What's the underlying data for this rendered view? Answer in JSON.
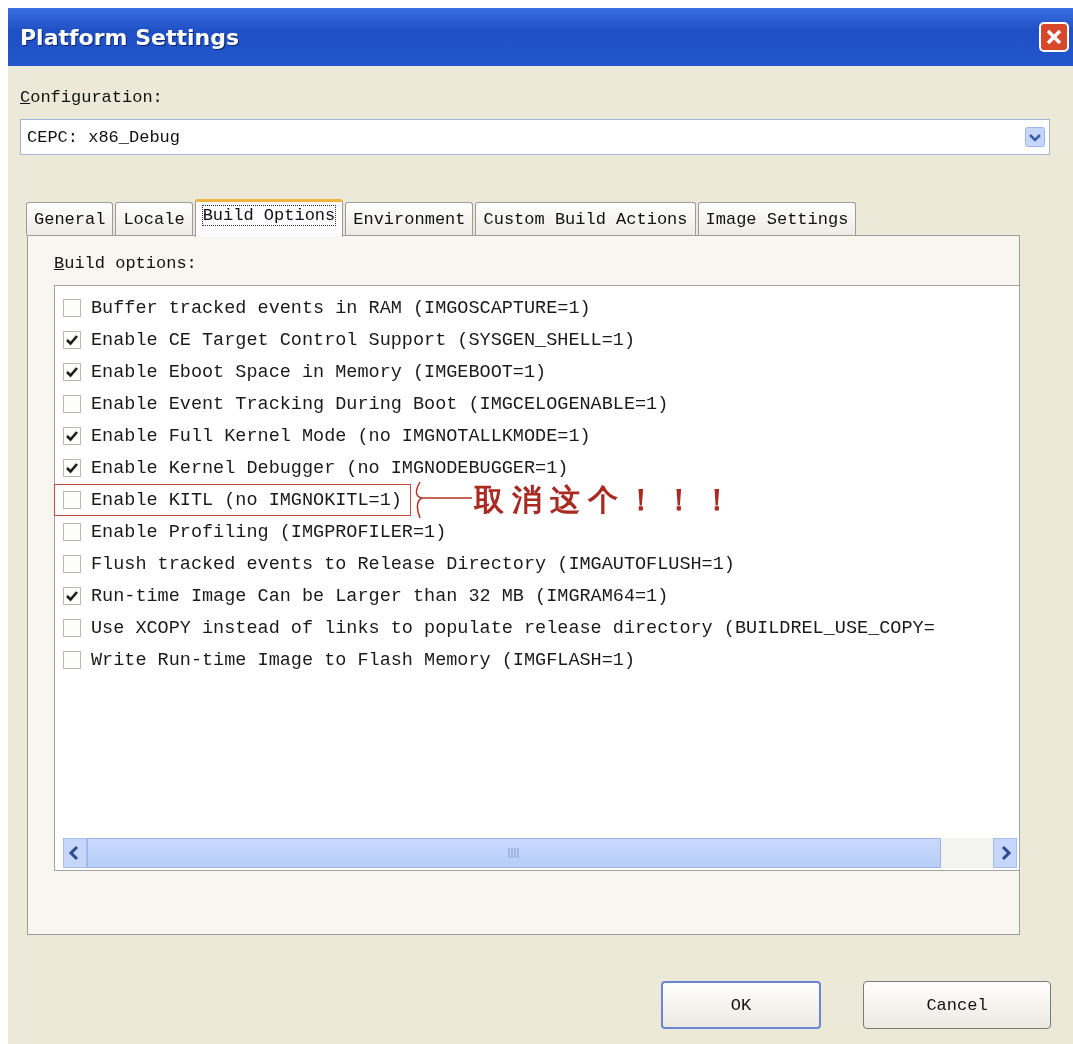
{
  "window": {
    "title": "Platform Settings"
  },
  "configuration": {
    "label": "Configuration:",
    "value": "CEPC: x86_Debug"
  },
  "tabs": [
    {
      "label": "General",
      "selected": false
    },
    {
      "label": "Locale",
      "selected": false
    },
    {
      "label": "Build Options",
      "selected": true
    },
    {
      "label": "Environment",
      "selected": false
    },
    {
      "label": "Custom Build Actions",
      "selected": false
    },
    {
      "label": "Image Settings",
      "selected": false
    }
  ],
  "build_options": {
    "label": "Build options:",
    "items": [
      {
        "label": "Buffer tracked events in RAM (IMGOSCAPTURE=1)",
        "checked": false,
        "highlighted": false
      },
      {
        "label": "Enable CE Target Control Support (SYSGEN_SHELL=1)",
        "checked": true,
        "highlighted": false
      },
      {
        "label": "Enable Eboot Space in Memory (IMGEBOOT=1)",
        "checked": true,
        "highlighted": false
      },
      {
        "label": "Enable Event Tracking During Boot (IMGCELOGENABLE=1)",
        "checked": false,
        "highlighted": false
      },
      {
        "label": "Enable Full Kernel Mode (no IMGNOTALLKMODE=1)",
        "checked": true,
        "highlighted": false
      },
      {
        "label": "Enable Kernel Debugger (no IMGNODEBUGGER=1)",
        "checked": true,
        "highlighted": false
      },
      {
        "label": "Enable KITL (no IMGNOKITL=1)",
        "checked": false,
        "highlighted": true
      },
      {
        "label": "Enable Profiling (IMGPROFILER=1)",
        "checked": false,
        "highlighted": false
      },
      {
        "label": "Flush tracked events to Release Directory (IMGAUTOFLUSH=1)",
        "checked": false,
        "highlighted": false
      },
      {
        "label": "Run-time Image Can be Larger than 32 MB (IMGRAM64=1)",
        "checked": true,
        "highlighted": false
      },
      {
        "label": "Use XCOPY instead of links to populate release directory (BUILDREL_USE_COPY=",
        "checked": false,
        "highlighted": false
      },
      {
        "label": "Write Run-time Image to Flash Memory (IMGFLASH=1)",
        "checked": false,
        "highlighted": false
      }
    ]
  },
  "annotation": {
    "text": "取消这个！！！"
  },
  "buttons": [
    {
      "label": "OK",
      "kind": "default"
    },
    {
      "label": "Cancel",
      "kind": "normal"
    }
  ]
}
